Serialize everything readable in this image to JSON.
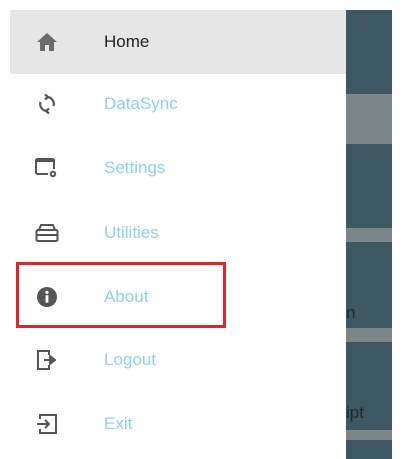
{
  "background_app": {
    "partial_labels": [
      "n",
      "ipt"
    ]
  },
  "drawer": {
    "items": [
      {
        "label": "Home",
        "icon": "home-icon",
        "active": true
      },
      {
        "label": "DataSync",
        "icon": "sync-icon"
      },
      {
        "label": "Settings",
        "icon": "settings-window-icon"
      },
      {
        "label": "Utilities",
        "icon": "toolbox-icon"
      },
      {
        "label": "About",
        "icon": "info-icon",
        "highlighted": true
      },
      {
        "label": "Logout",
        "icon": "logout-icon"
      },
      {
        "label": "Exit",
        "icon": "exit-icon"
      }
    ]
  },
  "colors": {
    "label_default": "#8fd0ec",
    "label_active": "#222222",
    "active_bg": "#e6e6e6",
    "highlight": "#e0242e",
    "app_bar": "#3d5860"
  }
}
